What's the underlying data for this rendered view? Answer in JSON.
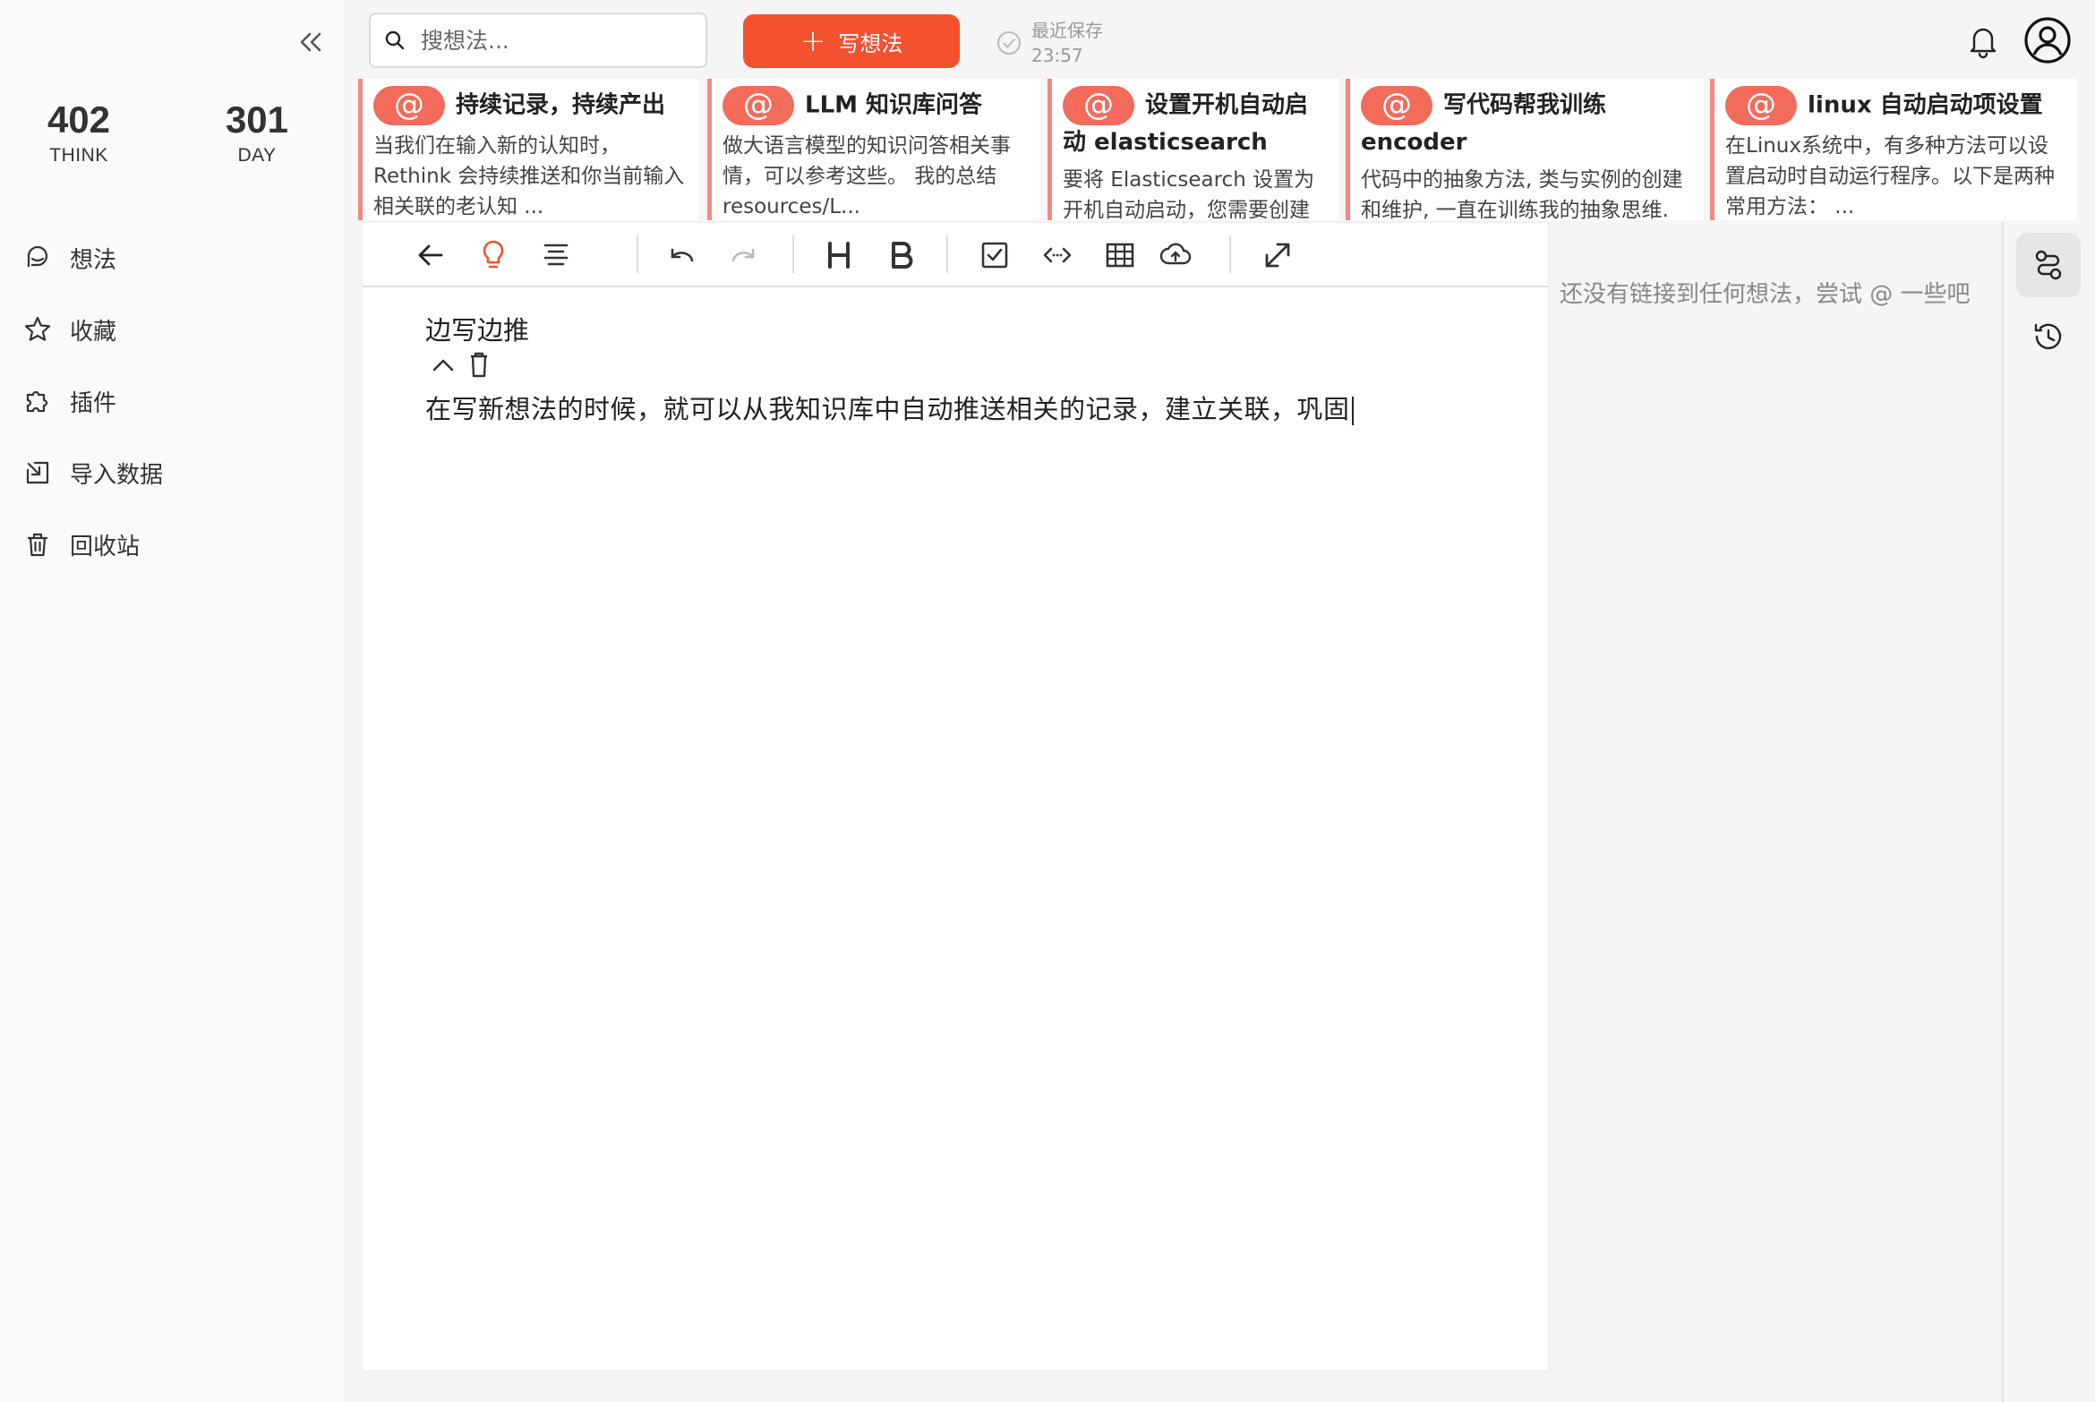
{
  "sidebar": {
    "stats": [
      {
        "value": "402",
        "label": "THINK"
      },
      {
        "value": "301",
        "label": "DAY"
      }
    ],
    "items": [
      {
        "label": "想法",
        "icon": "idea-bubble-icon"
      },
      {
        "label": "收藏",
        "icon": "star-icon"
      },
      {
        "label": "插件",
        "icon": "puzzle-icon"
      },
      {
        "label": "导入数据",
        "icon": "import-icon"
      },
      {
        "label": "回收站",
        "icon": "trash-icon"
      }
    ]
  },
  "header": {
    "search_placeholder": "搜想法...",
    "write_label": "写想法",
    "save_label": "最近保存",
    "save_time": "23:57"
  },
  "related_cards": [
    {
      "title": "持续记录，持续产出",
      "snippet": "当我们在输入新的认知时，Rethink 会持续推送和你当前输入相关联的老认知 ..."
    },
    {
      "title": "LLM 知识库问答",
      "snippet": "做大语言模型的知识问答相关事情，可以参考这些。 我的总结 resources/L..."
    },
    {
      "title": "设置开机自动启动 elasticsearch",
      "snippet": "要将 Elasticsearch 设置为开机自动启动，您需要创建"
    },
    {
      "title": "写代码帮我训练 encoder",
      "snippet": "代码中的抽象方法, 类与实例的创建和维护, 一直在训练我的抽象思维."
    },
    {
      "title": "linux 自动启动项设置",
      "snippet": "在Linux系统中，有多种方法可以设置启动时自动运行程序。以下是两种常用方法： ..."
    }
  ],
  "editor": {
    "title": "边写边推",
    "body": "在写新想法的时候，就可以从我知识库中自动推送相关的记录，建立关联，巩固"
  },
  "links_panel": {
    "empty_text": "还没有链接到任何想法，尝试 @ 一些吧"
  },
  "colors": {
    "accent": "#f4512f",
    "card_border": "#f08a82",
    "at_badge": "#f26b5b"
  }
}
